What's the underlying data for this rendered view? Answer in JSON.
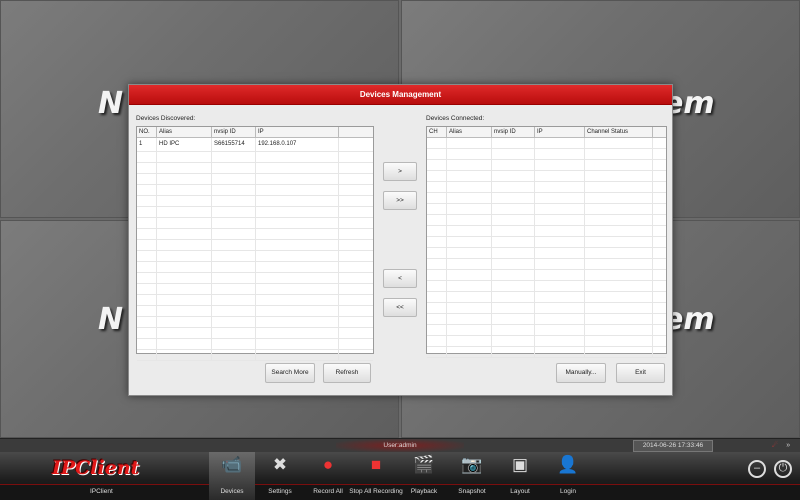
{
  "background": {
    "watermark_left": "N",
    "watermark_right": "em"
  },
  "dialog": {
    "title": "Devices Management",
    "discovered_label": "Devices Discovered:",
    "connected_label": "Devices Connected:",
    "discovered_columns": [
      "NO.",
      "Alias",
      "nvsip ID",
      "IP"
    ],
    "discovered_rows": [
      [
        "1",
        "HD IPC",
        "S66155714",
        "192.168.0.107"
      ]
    ],
    "connected_columns": [
      "CH",
      "Alias",
      "nvsip ID",
      "IP",
      "Channel Status"
    ],
    "connected_rows": [],
    "move_buttons": [
      ">",
      ">>",
      "<",
      "<<"
    ],
    "search_more": "Search More",
    "refresh": "Refresh",
    "manually": "Manually...",
    "exit": "Exit"
  },
  "statusbar": {
    "user": "User:admin",
    "datetime": "2014-06-26 17:33:46"
  },
  "toolbar": {
    "brand": "IPClient",
    "brand_label": "IPClient",
    "items": [
      {
        "label": "Devices",
        "icon": "devices-icon"
      },
      {
        "label": "Settings",
        "icon": "settings-icon"
      },
      {
        "label": "Record All",
        "icon": "record-all-icon"
      },
      {
        "label": "Stop All Recording",
        "icon": "stop-recording-icon"
      },
      {
        "label": "Playback",
        "icon": "playback-icon"
      },
      {
        "label": "Snapshot",
        "icon": "snapshot-icon"
      },
      {
        "label": "Layout",
        "icon": "layout-icon"
      },
      {
        "label": "Login",
        "icon": "login-icon"
      }
    ],
    "active": "Devices"
  },
  "colors": {
    "accent": "#c81010",
    "dialog_bg": "#ebebeb",
    "toolbar_bg": "#1c1c1c"
  }
}
